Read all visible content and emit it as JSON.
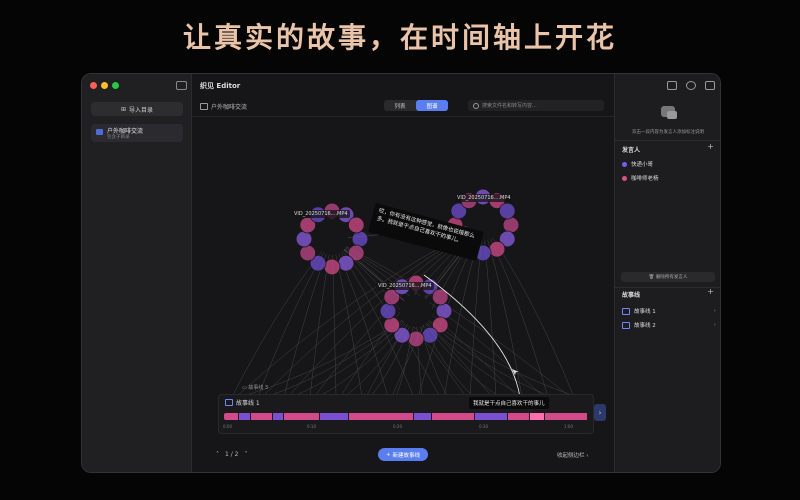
{
  "banner": {
    "title": "让真实的故事，在时间轴上开花"
  },
  "app": {
    "title": "织见 Editor"
  },
  "sidebar": {
    "import_label": "导入目录",
    "folder": {
      "name": "户外咖啡交流",
      "sub": "包含子目录"
    }
  },
  "toolbar": {
    "breadcrumb": "户外咖啡交流",
    "view_list": "列表",
    "view_graph": "图谱",
    "search_placeholder": "搜索文件名和转写内容..."
  },
  "graph": {
    "nodes": [
      {
        "label": "VID_20250716....MP4"
      },
      {
        "label": "VID_20250716....MP4"
      },
      {
        "label": "VID_20250716....MP4"
      }
    ],
    "tooltip": "哎，你有没有这种感觉，就像也说接那么多。我就是干点自己喜欢干的事儿。"
  },
  "timeline": {
    "hidden_label": "故事线 3",
    "title": "故事线 1",
    "tip": "我就是干点自己喜欢干的事儿",
    "ticks": [
      "0:00",
      "0:10",
      "0:20",
      "0:30",
      "1:00"
    ],
    "segments": [
      {
        "w": 4,
        "c": "#d14a8a"
      },
      {
        "w": 3,
        "c": "#7a4fd0"
      },
      {
        "w": 6,
        "c": "#d14a8a"
      },
      {
        "w": 3,
        "c": "#7a4fd0"
      },
      {
        "w": 10,
        "c": "#d14a8a"
      },
      {
        "w": 8,
        "c": "#7a4fd0"
      },
      {
        "w": 18,
        "c": "#d14a8a"
      },
      {
        "w": 5,
        "c": "#7a4fd0"
      },
      {
        "w": 12,
        "c": "#d14a8a"
      },
      {
        "w": 9,
        "c": "#7a4fd0"
      },
      {
        "w": 6,
        "c": "#d14a8a"
      },
      {
        "w": 4,
        "c": "#ff6fb0"
      },
      {
        "w": 12,
        "c": "#d14a8a"
      }
    ]
  },
  "bottom": {
    "pager": "1 / 2",
    "new_story": "新建故事线",
    "collapse": "收起侧边栏"
  },
  "right_panel": {
    "hint": "双击一段内容为发言人添加标注说明",
    "speakers_title": "发言人",
    "speakers": [
      {
        "name": "快递小哥",
        "color": "#7a5cf0"
      },
      {
        "name": "咖啡师老杨",
        "color": "#e0507f"
      }
    ],
    "delete_all": "删除所有发言人",
    "stories_title": "故事线",
    "stories": [
      {
        "name": "故事线 1"
      },
      {
        "name": "故事线 2"
      }
    ]
  }
}
